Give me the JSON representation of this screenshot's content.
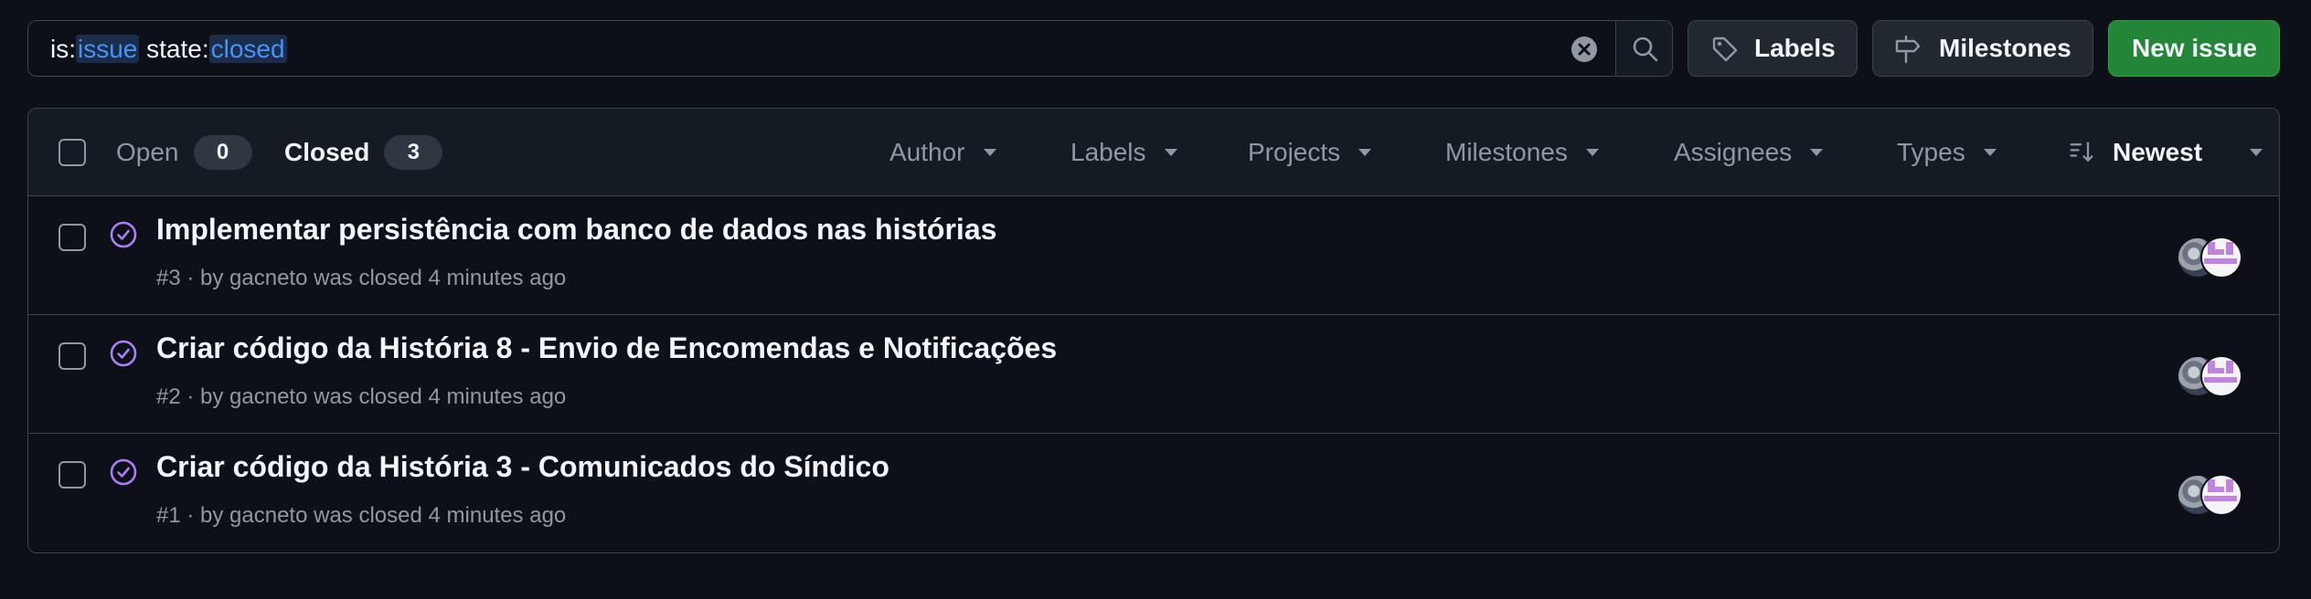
{
  "search": {
    "tokens": [
      {
        "key": "is:",
        "value": "issue"
      },
      {
        "key": " state:",
        "value": "closed"
      }
    ]
  },
  "toolbar": {
    "labels_button": "Labels",
    "milestones_button": "Milestones",
    "new_issue_button": "New issue"
  },
  "states": {
    "open_label": "Open",
    "open_count": "0",
    "closed_label": "Closed",
    "closed_count": "3"
  },
  "filters": [
    "Author",
    "Labels",
    "Projects",
    "Milestones",
    "Assignees",
    "Types"
  ],
  "sort": {
    "label": "Newest"
  },
  "issues": [
    {
      "title": "Implementar persistência com banco de dados nas histórias",
      "meta": "#3 · by gacneto was closed 4 minutes ago"
    },
    {
      "title": "Criar código da História 8 - Envio de Encomendas e Notificações",
      "meta": "#2 · by gacneto was closed 4 minutes ago"
    },
    {
      "title": "Criar código da História 3 - Comunicados do Síndico",
      "meta": "#1 · by gacneto was closed 4 minutes ago"
    }
  ],
  "colors": {
    "background": "#0d1117",
    "border": "#3d444d",
    "accent_blue": "#4493f8",
    "primary_green": "#238636",
    "closed_purple": "#ab7df8"
  }
}
